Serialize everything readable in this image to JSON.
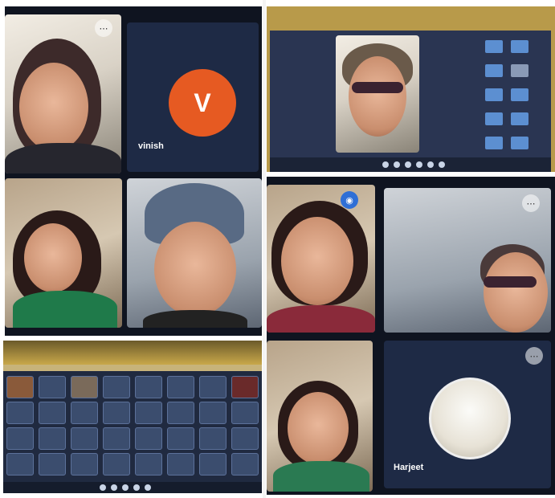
{
  "participants": [
    {
      "id": "top-left-woman",
      "name": ""
    },
    {
      "id": "vinish",
      "name": "vinish",
      "avatar_letter": "V"
    },
    {
      "id": "mid-left-woman",
      "name": ""
    },
    {
      "id": "man-beanie",
      "name": ""
    },
    {
      "id": "woman-bindi",
      "name": ""
    },
    {
      "id": "woman-sunglasses",
      "name": ""
    },
    {
      "id": "bottom-woman",
      "name": ""
    },
    {
      "id": "harjeet",
      "name": "Harjeet"
    }
  ],
  "colors": {
    "tile_dark": "#1e2a45",
    "avatar_orange": "#e65a22",
    "badge_blue": "#2f6fd6"
  },
  "icons": [
    "dots-icon",
    "audio-wave-icon",
    "toolbar-icons"
  ]
}
